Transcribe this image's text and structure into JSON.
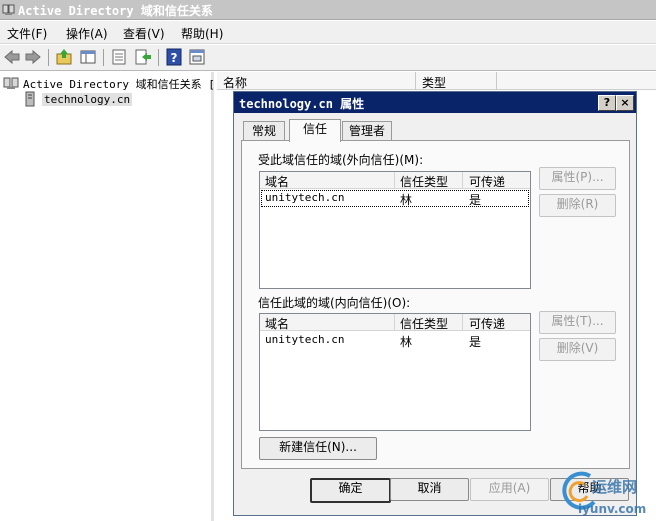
{
  "window": {
    "title": "Active Directory 域和信任关系"
  },
  "menu": [
    "文件(F)",
    "操作(A)",
    "查看(V)",
    "帮助(H)"
  ],
  "toolbar": {
    "icons": [
      "back-icon",
      "forward-icon",
      "up-folder-icon",
      "show-tree-icon",
      "properties-icon",
      "export-icon",
      "help-icon",
      "console-icon"
    ]
  },
  "tree": {
    "root": "Active Directory 域和信任关系 [",
    "child": "technology.cn"
  },
  "list": {
    "columns": [
      "名称",
      "类型"
    ]
  },
  "dialog": {
    "title": "technology.cn 属性",
    "help_btn": "?",
    "close_btn": "×",
    "tabs": [
      "常规",
      "信任",
      "管理者"
    ],
    "outgoing": {
      "label": "受此域信任的域(外向信任)(M):",
      "columns": [
        "域名",
        "信任类型",
        "可传递"
      ],
      "rows": [
        {
          "domain": "unitytech.cn",
          "type": "林",
          "transitive": "是"
        }
      ],
      "properties_btn": "属性(P)...",
      "remove_btn": "删除(R)"
    },
    "incoming": {
      "label": "信任此域的域(内向信任)(O):",
      "columns": [
        "域名",
        "信任类型",
        "可传递"
      ],
      "rows": [
        {
          "domain": "unitytech.cn",
          "type": "林",
          "transitive": "是"
        }
      ],
      "properties_btn": "属性(T)...",
      "remove_btn": "删除(V)"
    },
    "new_trust_btn": "新建信任(N)...",
    "ok": "确定",
    "cancel": "取消",
    "apply": "应用(A)",
    "help": "帮助"
  },
  "watermark": {
    "text": "运维网",
    "url": "iyunv.com"
  },
  "colors": {
    "dialog_title_bg": "#0a246a",
    "selection": "#0a246a",
    "panel": "#f0f0f0"
  }
}
